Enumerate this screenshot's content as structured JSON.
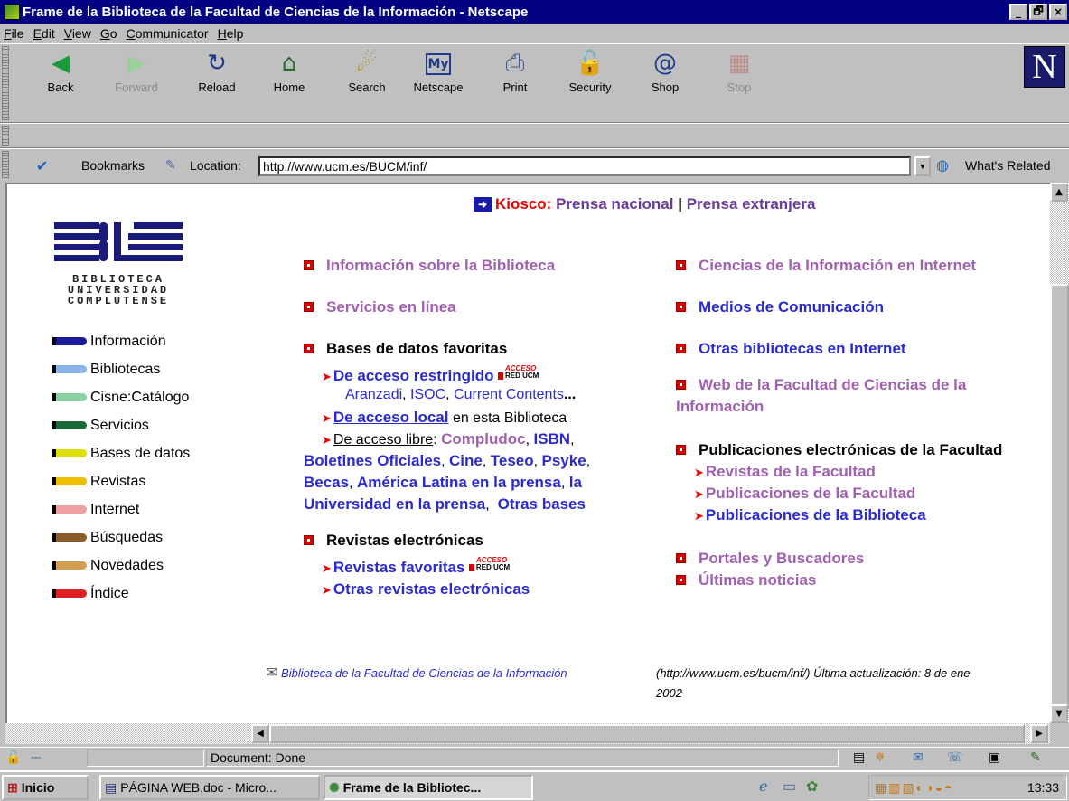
{
  "window": {
    "title": "Frame de la Biblioteca de la Facultad de Ciencias de la Información - Netscape",
    "buttons": [
      "_",
      "🗗",
      "×"
    ]
  },
  "menu": [
    "File",
    "Edit",
    "View",
    "Go",
    "Communicator",
    "Help"
  ],
  "toolbar": {
    "back": "Back",
    "forward": "Forward",
    "reload": "Reload",
    "home": "Home",
    "search": "Search",
    "netscape": "Netscape",
    "print": "Print",
    "security": "Security",
    "shop": "Shop",
    "stop": "Stop",
    "logo": "N"
  },
  "location": {
    "bookmarks": "Bookmarks",
    "label": "Location:",
    "url": "http://www.ucm.es/BUCM/inf/",
    "related": "What's Related"
  },
  "page": {
    "kiosco": {
      "label": "Kiosco:",
      "link1": "Prensa nacional",
      "sep": "|",
      "link2": "Prensa extranjera"
    },
    "logo_lines": [
      "BIBLIOTECA",
      "UNIVERSIDAD",
      "COMPLUTENSE"
    ],
    "nav": [
      {
        "label": "Información",
        "color": "#1a1a9a"
      },
      {
        "label": "Bibliotecas",
        "color": "#8ab4e8"
      },
      {
        "label": "Cisne:Catálogo",
        "color": "#8ad0a0"
      },
      {
        "label": "Servicios",
        "color": "#1a6a3a"
      },
      {
        "label": "Bases de datos",
        "color": "#e0e000"
      },
      {
        "label": "Revistas",
        "color": "#f0c000"
      },
      {
        "label": "Internet",
        "color": "#f0a0a0"
      },
      {
        "label": "Búsquedas",
        "color": "#8a5a2a"
      },
      {
        "label": "Novedades",
        "color": "#d0a050"
      },
      {
        "label": "Índice",
        "color": "#e02020"
      }
    ],
    "mid": {
      "info": "Información sobre la Biblioteca",
      "servicios": "Servicios en línea",
      "bases": "Bases de datos favoritas",
      "restringido": "De acceso restringido",
      "badge_top": "ACCESO",
      "badge_bottom": "RED UCM",
      "aranzadi": "Aranzadi",
      "isoc": "ISOC",
      "current": "Current Contents",
      "ellipsis": "...",
      "local": "De acceso local",
      "local_rest": "en esta Biblioteca",
      "libre": "De acceso libre",
      "compludoc": "Compludoc",
      "isbn": "ISBN",
      "boletines": "Boletines Oficiales",
      "cine": "Cine",
      "teseo": "Teseo",
      "psyke": "Psyke",
      "becas": "Becas",
      "america": "América Latina en la prensa",
      "la": "la",
      "universidad": "Universidad en la prensa",
      "otras_bases": "Otras bases",
      "revistas": "Revistas electrónicas",
      "favoritas": "Revistas favoritas",
      "otras_revistas": "Otras revistas electrónicas"
    },
    "right": {
      "ciencias": "Ciencias de la Información en Internet",
      "medios": "Medios de Comunicación",
      "otras_bib": "Otras bibliotecas en Internet",
      "web": "Web de la Facultad de Ciencias de la",
      "web2": "Información",
      "publicaciones": "Publicaciones electrónicas de la Facultad",
      "rev_fac": "Revistas de la Facultad",
      "pub_fac": "Publicaciones de la Facultad",
      "pub_bib": "Publicaciones de la Biblioteca",
      "portales": "Portales y Buscadores",
      "noticias": "Últimas noticias"
    },
    "footer": {
      "link": "Biblioteca de la Facultad de Ciencias de la Información",
      "info": "(http://www.ucm.es/bucm/inf/) Última actualización: 8 de ene",
      "year": "2002"
    }
  },
  "status": {
    "text": "Document: Done"
  },
  "taskbar": {
    "start": "Inicio",
    "task1": "PÁGINA WEB.doc - Micro...",
    "task2": "Frame de la Bibliotec...",
    "clock": "13:33"
  }
}
